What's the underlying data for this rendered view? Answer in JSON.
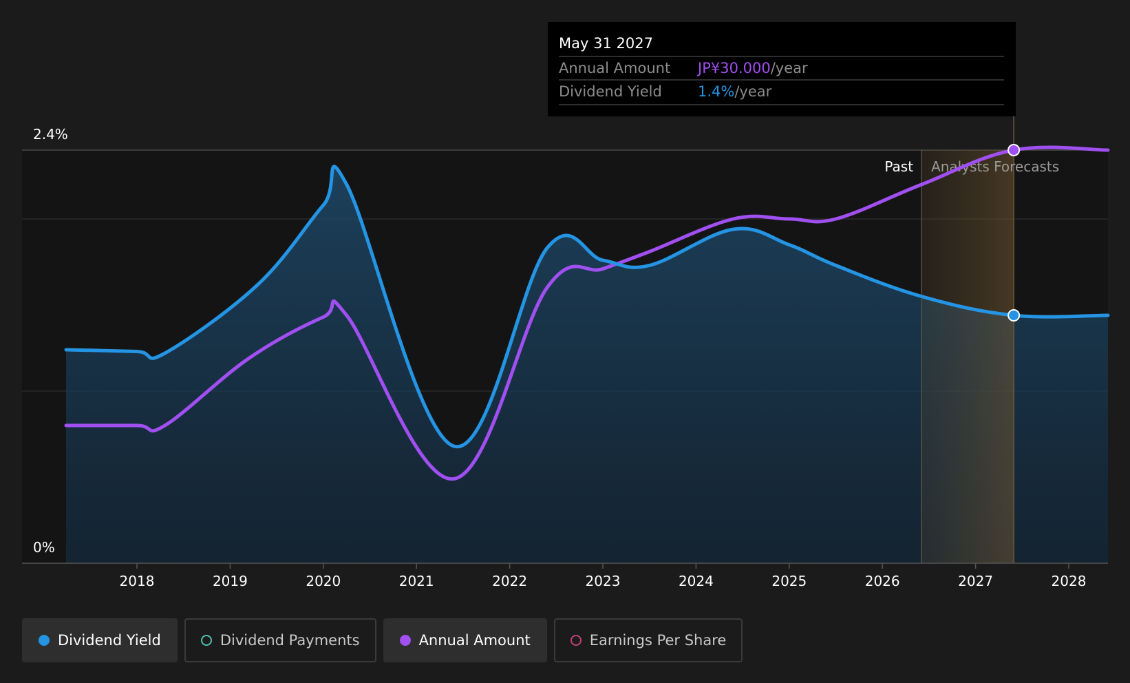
{
  "chart_data": {
    "type": "area",
    "x_ticks": [
      "2018",
      "2019",
      "2020",
      "2021",
      "2022",
      "2023",
      "2024",
      "2025",
      "2026",
      "2027",
      "2028"
    ],
    "y_tick_labels": {
      "top": "2.4%",
      "bottom": "0%"
    },
    "ylim": [
      0,
      2.4
    ],
    "xlim": [
      2017.25,
      2028.4
    ],
    "past_label": "Past",
    "forecast_label": "Analysts Forecasts",
    "forecast_start": 2026.42,
    "highlight_date": 2027.41,
    "series": [
      {
        "name": "Dividend Yield",
        "color": "#2494e3",
        "points": [
          [
            2017.3,
            1.24
          ],
          [
            2018.0,
            1.23
          ],
          [
            2018.3,
            1.22
          ],
          [
            2019.3,
            1.62
          ],
          [
            2020.0,
            2.08
          ],
          [
            2020.25,
            2.2
          ],
          [
            2021.4,
            0.68
          ],
          [
            2022.4,
            1.83
          ],
          [
            2023.0,
            1.76
          ],
          [
            2023.5,
            1.73
          ],
          [
            2024.4,
            1.94
          ],
          [
            2025.0,
            1.85
          ],
          [
            2025.5,
            1.73
          ],
          [
            2026.42,
            1.55
          ],
          [
            2027.41,
            1.44
          ],
          [
            2028.4,
            1.44
          ]
        ]
      },
      {
        "name": "Annual Amount",
        "color": "#a04ff0",
        "points": [
          [
            2017.3,
            0.8
          ],
          [
            2018.0,
            0.8
          ],
          [
            2018.3,
            0.8
          ],
          [
            2019.2,
            1.19
          ],
          [
            2020.0,
            1.43
          ],
          [
            2020.25,
            1.44
          ],
          [
            2021.4,
            0.49
          ],
          [
            2022.4,
            1.6
          ],
          [
            2023.0,
            1.71
          ],
          [
            2023.5,
            1.81
          ],
          [
            2024.4,
            2.0
          ],
          [
            2025.0,
            2.0
          ],
          [
            2025.5,
            2.0
          ],
          [
            2026.42,
            2.2
          ],
          [
            2027.41,
            2.4
          ],
          [
            2028.4,
            2.4
          ]
        ]
      }
    ],
    "tooltip": {
      "date": "May 31 2027",
      "rows": [
        {
          "label": "Annual Amount",
          "value": "JP¥30.000",
          "unit": "/year",
          "color": "#a04ff0"
        },
        {
          "label": "Dividend Yield",
          "value": "1.4%",
          "unit": "/year",
          "color": "#2494e3"
        }
      ]
    },
    "legend": [
      {
        "label": "Dividend Yield",
        "color": "#2494e3",
        "style": "filled",
        "active": true
      },
      {
        "label": "Dividend Payments",
        "color": "#4fc1b0",
        "style": "hollow",
        "active": false
      },
      {
        "label": "Annual Amount",
        "color": "#a04ff0",
        "style": "filled",
        "active": true
      },
      {
        "label": "Earnings Per Share",
        "color": "#c0407a",
        "style": "hollow",
        "active": false
      }
    ]
  }
}
